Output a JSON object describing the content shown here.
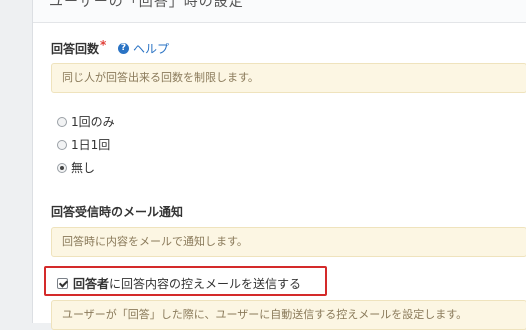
{
  "panel": {
    "title": "ユーザーの「回答」時の設定"
  },
  "answer_count": {
    "label": "回答回数",
    "required_mark": "*",
    "help_label": "ヘルプ",
    "help_icon": "question-circle-icon",
    "note": "同じ人が回答出来る回数を制限します。",
    "options": [
      {
        "label": "1回のみ",
        "checked": false
      },
      {
        "label": "1日1回",
        "checked": false
      },
      {
        "label": "無し",
        "checked": true
      }
    ]
  },
  "mail_notify": {
    "label": "回答受信時のメール通知",
    "note": "回答時に内容をメールで通知します。",
    "checkbox": {
      "bold_part": "回答者",
      "rest_part": "に回答内容の控えメールを送信する",
      "checked": true
    },
    "note2": "ユーザーが「回答」した際に、ユーザーに自動送信する控えメールを設定します。"
  },
  "colors": {
    "highlight": "#d42a2a",
    "link": "#2a73c4",
    "note_bg": "#fcf6e3"
  }
}
